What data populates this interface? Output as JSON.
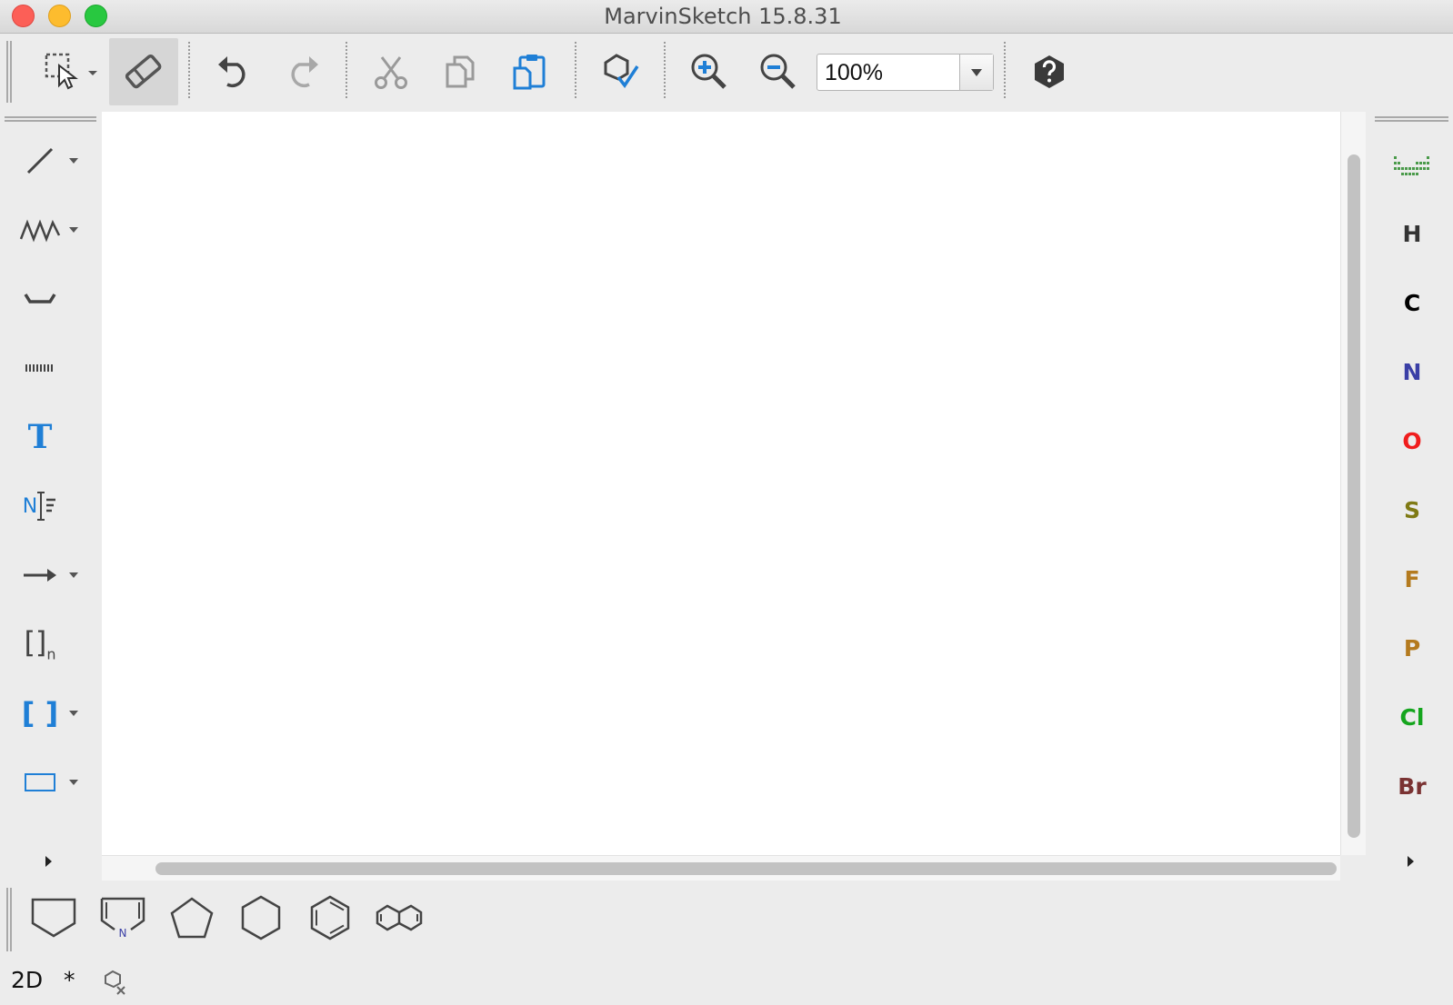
{
  "window": {
    "title": "MarvinSketch 15.8.31"
  },
  "toolbar": {
    "zoom_value": "100%",
    "icons": [
      "selection-rectangle-icon",
      "eraser-icon",
      "undo-icon",
      "redo-icon",
      "cut-icon",
      "copy-icon",
      "paste-icon",
      "structure-check-icon",
      "zoom-in-icon",
      "zoom-out-icon",
      "help-icon"
    ],
    "active_tool": "eraser"
  },
  "left_tools": {
    "items": [
      {
        "icon": "single-bond-icon",
        "text": ""
      },
      {
        "icon": "chain-icon",
        "text": ""
      },
      {
        "icon": "sprout-icon",
        "text": ""
      },
      {
        "icon": "dashed-line-icon",
        "text": ""
      },
      {
        "icon": "text-icon",
        "text": "T"
      },
      {
        "icon": "atom-label-text-icon",
        "text": "N"
      },
      {
        "icon": "reaction-arrow-icon",
        "text": ""
      },
      {
        "icon": "repeating-unit-bracket-icon",
        "text": "[]",
        "subscript": "n"
      },
      {
        "icon": "bracket-icon",
        "text": "[ ]"
      },
      {
        "icon": "rectangle-icon",
        "text": ""
      }
    ]
  },
  "atoms": [
    {
      "symbol": "H",
      "color": "#333333"
    },
    {
      "symbol": "C",
      "color": "#000000"
    },
    {
      "symbol": "N",
      "color": "#3a3fa6"
    },
    {
      "symbol": "O",
      "color": "#f01d1d"
    },
    {
      "symbol": "S",
      "color": "#7f7a14"
    },
    {
      "symbol": "F",
      "color": "#b47a1e"
    },
    {
      "symbol": "P",
      "color": "#b47a1e"
    },
    {
      "symbol": "Cl",
      "color": "#15a51e"
    },
    {
      "symbol": "Br",
      "color": "#7a3232"
    }
  ],
  "templates": {
    "items": [
      "cyclopentane-house-icon",
      "pyrrole-house-icon",
      "cyclopentane-icon",
      "cyclohexane-icon",
      "benzene-icon",
      "naphthalene-icon"
    ],
    "pyrrole_label": "N"
  },
  "status": {
    "mode": "2D",
    "modified": "*"
  },
  "colors": {
    "accent_blue": "#1f7fd6",
    "icon_gray": "#555555"
  }
}
